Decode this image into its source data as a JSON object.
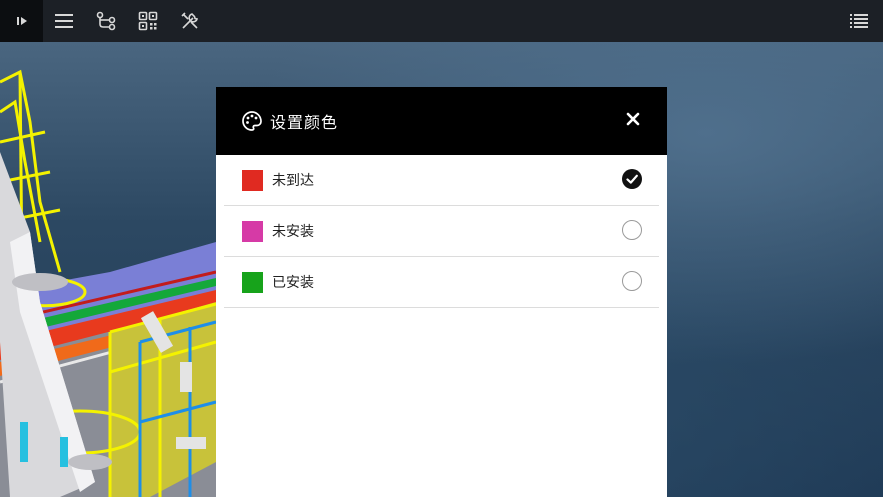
{
  "dialog": {
    "title": "设置颜色",
    "options": [
      {
        "label": "未到达",
        "color": "#e02a21",
        "selected": true
      },
      {
        "label": "未安装",
        "color": "#d63aa6",
        "selected": false
      },
      {
        "label": "已安装",
        "color": "#17a31b",
        "selected": false
      }
    ]
  },
  "toolbar": {
    "icons": [
      "play-panel-icon",
      "menu-icon",
      "route-icon",
      "qr-code-icon",
      "tools-icon",
      "list-icon"
    ]
  },
  "colors": {
    "toolbar_bg": "#1c2026",
    "dialog_header_bg": "#000000",
    "accent_yellow": "#f4f200"
  }
}
